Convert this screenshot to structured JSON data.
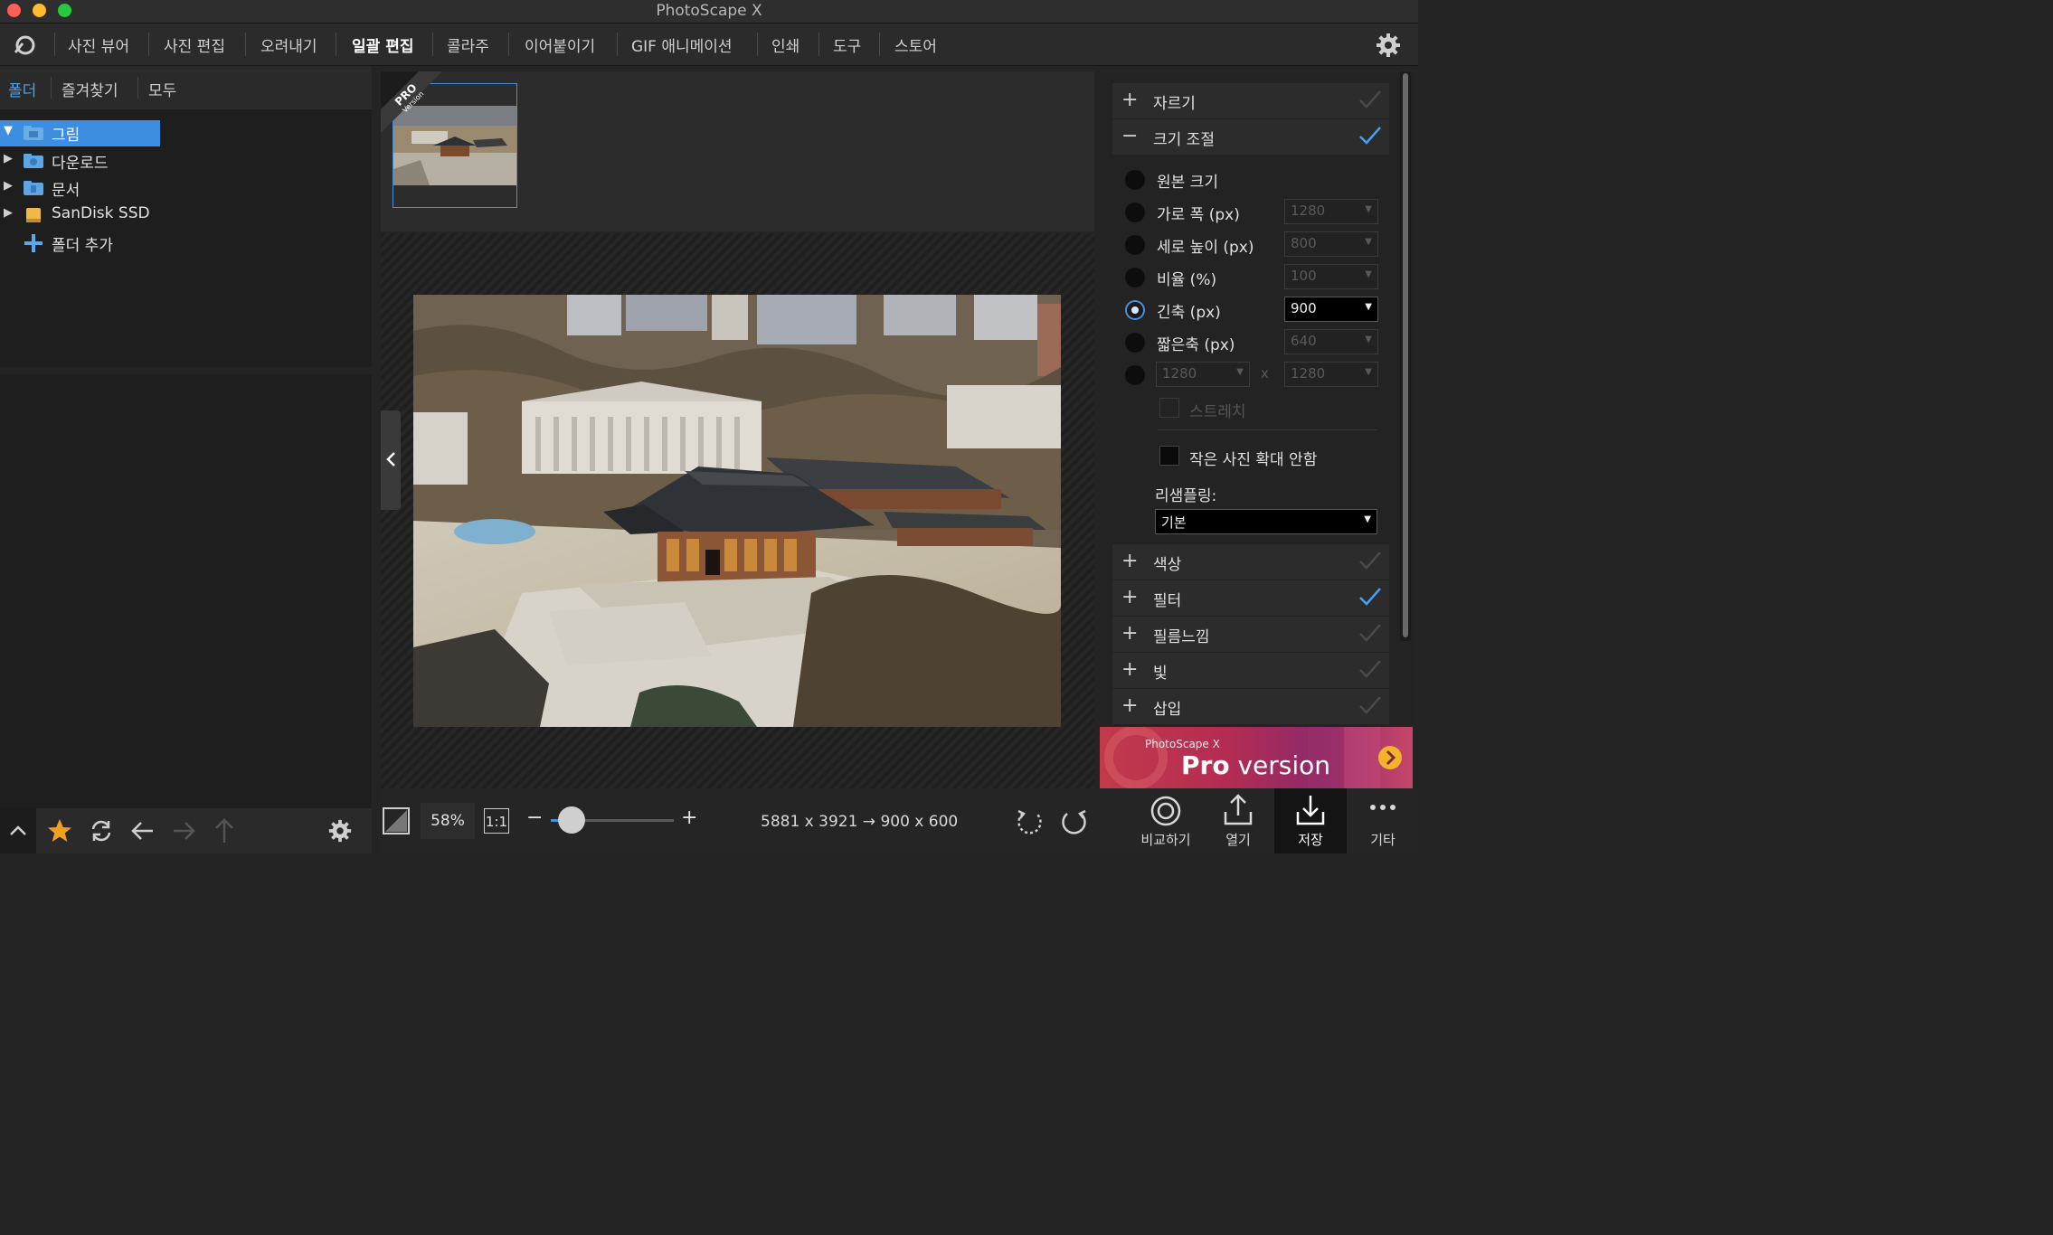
{
  "window": {
    "title": "PhotoScape X"
  },
  "menu": {
    "items": [
      "사진 뷰어",
      "사진 편집",
      "오려내기",
      "일괄 편집",
      "콜라주",
      "이어붙이기",
      "GIF 애니메이션",
      "인쇄",
      "도구",
      "스토어"
    ],
    "active_index": 3
  },
  "left": {
    "tabs": [
      "폴더",
      "즐겨찾기",
      "모두"
    ],
    "active_tab": 0,
    "tree": [
      {
        "label": "그림",
        "expanded": true,
        "selected": true
      },
      {
        "label": "다운로드"
      },
      {
        "label": "문서"
      },
      {
        "label": "SanDisk SSD"
      },
      {
        "label": "폴더 추가"
      }
    ]
  },
  "thumbnail": {
    "badge_main": "PRO",
    "badge_sub": "Version"
  },
  "bottom": {
    "zoom": "58%",
    "actual_size": "1:1",
    "minus": "−",
    "plus": "+",
    "size_info": "5881 x 3921 → 900 x 600",
    "zoom_slider_value": 0.17
  },
  "right": {
    "sections_top": [
      {
        "sign": "+",
        "label": "자르기",
        "checked": false
      },
      {
        "sign": "−",
        "label": "크기 조절",
        "checked": true
      }
    ],
    "resize_options": [
      {
        "label": "원본 크기",
        "selected": false
      },
      {
        "label": "가로 폭 (px)",
        "selected": false,
        "value": "1280"
      },
      {
        "label": "세로 높이 (px)",
        "selected": false,
        "value": "800"
      },
      {
        "label": "비율 (%)",
        "selected": false,
        "value": "100"
      },
      {
        "label": "긴축 (px)",
        "selected": true,
        "value": "900"
      },
      {
        "label": "짧은축 (px)",
        "selected": false,
        "value": "640"
      }
    ],
    "custom": {
      "w": "1280",
      "x": "x",
      "h": "1280"
    },
    "stretch_label": "스트레치",
    "no_enlarge_label": "작은 사진 확대 안함",
    "resampling_label": "리샘플링:",
    "resampling_value": "기본",
    "sections_bottom": [
      {
        "sign": "+",
        "label": "색상",
        "checked": false
      },
      {
        "sign": "+",
        "label": "필터",
        "checked": true
      },
      {
        "sign": "+",
        "label": "필름느낌",
        "checked": false
      },
      {
        "sign": "+",
        "label": "빛",
        "checked": false
      },
      {
        "sign": "+",
        "label": "삽입",
        "checked": false
      }
    ]
  },
  "promo": {
    "small": "PhotoScape X",
    "big_bold": "Pro",
    "big_rest": " version"
  },
  "actions": [
    {
      "label": "비교하기",
      "icon": "compare-icon"
    },
    {
      "label": "열기",
      "icon": "open-icon"
    },
    {
      "label": "저장",
      "icon": "save-icon",
      "active": true
    },
    {
      "label": "기타",
      "icon": "more-icon"
    }
  ],
  "colors": {
    "accent": "#4fa3f0",
    "selection": "#3d8de0",
    "check_on": "#4aa0f0"
  }
}
